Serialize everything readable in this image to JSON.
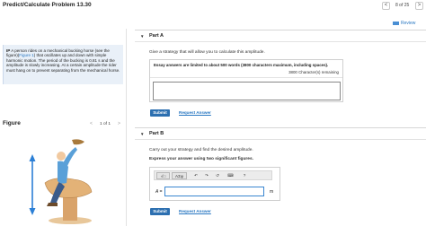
{
  "header": {
    "title": "Predict/Calculate Problem 13.30",
    "prev_label": "<",
    "next_label": ">",
    "page_count": "8 of 25"
  },
  "review": {
    "label": "Review"
  },
  "problem": {
    "ip_tag": "IP",
    "text_1": "A person rides on a mechanical bucking horse (see the figure)(",
    "figure_link": "Figure 1",
    "text_2": ") that oscillates up and down with simple harmonic motion. The period of the bucking is 0.81 s and the amplitude is slowly increasing. At a certain amplitude the rider must hang on to prevent separating from the mechanical horse."
  },
  "figure": {
    "label": "Figure",
    "prev_label": "<",
    "next_label": ">",
    "count": "1 of 1"
  },
  "part_a": {
    "title": "Part A",
    "prompt": "Give a strategy that will allow you to calculate this amplitude.",
    "limit_text": "Essay answers are limited to about 500 words (3800 characters maximum, including spaces).",
    "remaining_text": "3800 Character(s) remaining",
    "submit_label": "Submit",
    "request_label": "Request Answer"
  },
  "part_b": {
    "title": "Part B",
    "prompt": "Carry out your strategy and find the desired amplitude.",
    "instruction": "Express your answer using two significant figures.",
    "toolbar": {
      "templates": "√□",
      "symbols": "ΑΣφ",
      "undo": "↶",
      "redo": "↷",
      "reset": "↺",
      "keyboard": "⌨",
      "help": "?"
    },
    "var_label": "A =",
    "unit": "m",
    "submit_label": "Submit",
    "request_label": "Request Answer"
  },
  "icons": {
    "review": "review-icon",
    "part_toggle": "triangle-down-icon"
  },
  "colors": {
    "link": "#2a78c2",
    "submit": "#2c6fb0",
    "problem_bg": "#e9f0f8",
    "figure_arrow": "#2b7fd6"
  }
}
